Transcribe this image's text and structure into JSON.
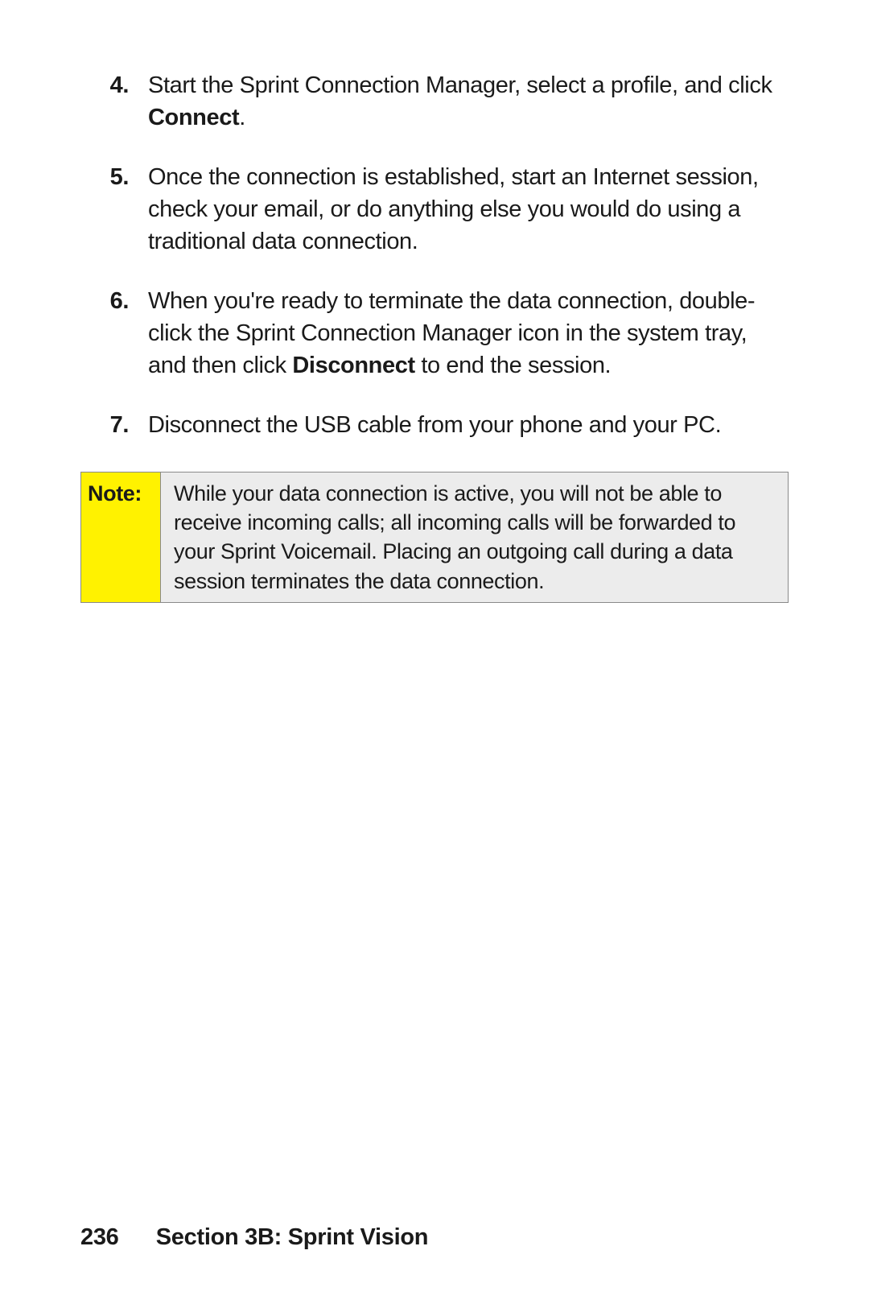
{
  "steps": [
    {
      "num": "4.",
      "pre": "Start the Sprint Connection Manager, select a profile, and click ",
      "bold": "Connect",
      "post": "."
    },
    {
      "num": "5.",
      "plain": "Once the connection is established, start an Internet session, check your email, or do anything else you would do using a traditional data connection."
    },
    {
      "num": "6.",
      "pre": "When you're ready to terminate the data connection, double-click the Sprint Connection Manager icon in the system tray, and then click ",
      "bold": "Disconnect",
      "post": " to end the session."
    },
    {
      "num": "7.",
      "plain": "Disconnect the USB cable from your phone and your PC."
    }
  ],
  "note": {
    "label": "Note:",
    "body": "While your data connection is active, you will not be able to receive incoming calls; all incoming calls will be forwarded to your Sprint Voicemail. Placing an outgoing call during a data session terminates the data connection."
  },
  "footer": {
    "page_number": "236",
    "section_label": "Section 3B: Sprint Vision"
  }
}
